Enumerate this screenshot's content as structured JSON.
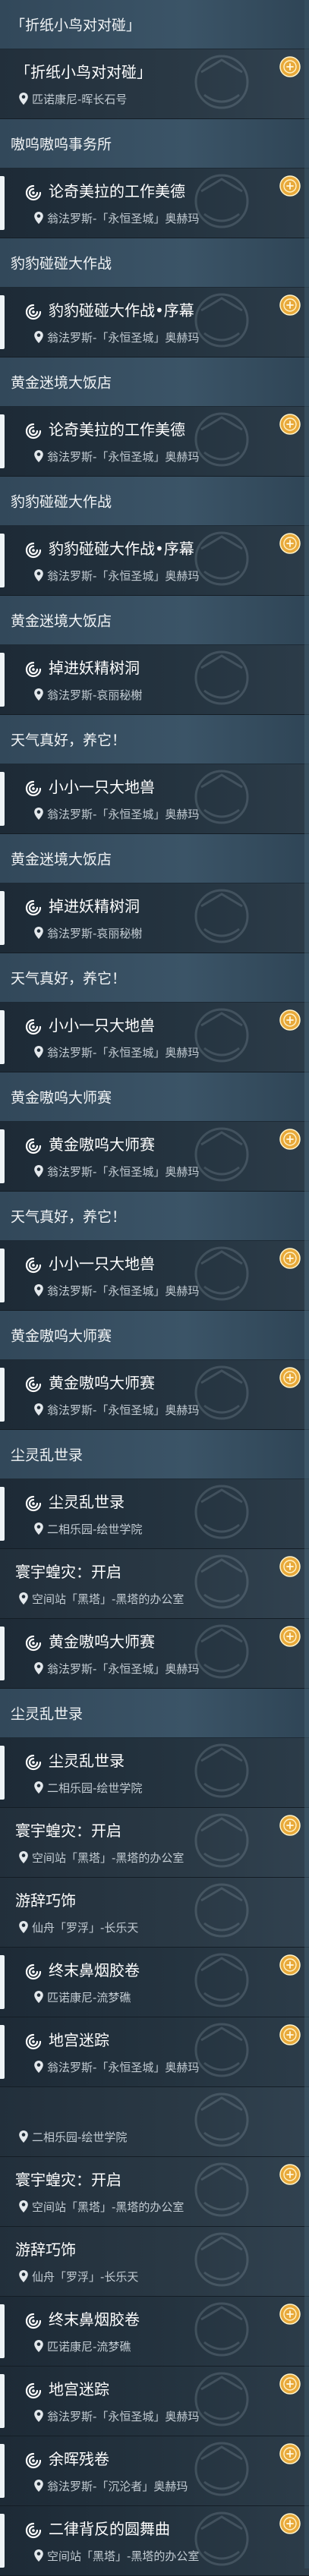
{
  "colors": {
    "header_bg": "#3b5467",
    "item_bg": "#24333f",
    "title_text": "#ffffff",
    "location_text": "#c3ccd3",
    "badge_gold": "#e8a93a"
  },
  "rows": [
    {
      "kind": "header",
      "text": "「折纸小鸟对对碰」"
    },
    {
      "kind": "item",
      "title": "「折纸小鸟对对碰」",
      "location": "匹诺康尼-晖长石号",
      "variant": "sub",
      "quest_icon": "none",
      "badge": true
    },
    {
      "kind": "header",
      "text": "嗷呜嗷呜事务所"
    },
    {
      "kind": "item",
      "title": "论奇美拉的工作美德",
      "location": "翁法罗斯-「永恒圣城」奥赫玛",
      "variant": "main",
      "quest_icon": "swirl-icon",
      "badge": true
    },
    {
      "kind": "header",
      "text": "豹豹碰碰大作战"
    },
    {
      "kind": "item",
      "title": "豹豹碰碰大作战•序幕",
      "location": "翁法罗斯-「永恒圣城」奥赫玛",
      "variant": "main",
      "quest_icon": "swirl-icon",
      "badge": true
    },
    {
      "kind": "header",
      "text": "黄金迷境大饭店"
    },
    {
      "kind": "item",
      "title": "论奇美拉的工作美德",
      "location": "翁法罗斯-「永恒圣城」奥赫玛",
      "variant": "main",
      "quest_icon": "swirl-icon",
      "badge": true
    },
    {
      "kind": "header",
      "text": "豹豹碰碰大作战"
    },
    {
      "kind": "item",
      "title": "豹豹碰碰大作战•序幕",
      "location": "翁法罗斯-「永恒圣城」奥赫玛",
      "variant": "main",
      "quest_icon": "swirl-icon",
      "badge": true
    },
    {
      "kind": "header",
      "text": "黄金迷境大饭店"
    },
    {
      "kind": "item",
      "title": "掉进妖精树洞",
      "location": "翁法罗斯-哀丽秘榭",
      "variant": "main",
      "quest_icon": "swirl-icon",
      "badge": false
    },
    {
      "kind": "header",
      "text": "天气真好，养它！"
    },
    {
      "kind": "item",
      "title": "小小一只大地兽",
      "location": "翁法罗斯-「永恒圣城」奥赫玛",
      "variant": "main",
      "quest_icon": "swirl-icon",
      "badge": false
    },
    {
      "kind": "header",
      "text": "黄金迷境大饭店"
    },
    {
      "kind": "item",
      "title": "掉进妖精树洞",
      "location": "翁法罗斯-哀丽秘榭",
      "variant": "main",
      "quest_icon": "swirl-icon",
      "badge": false
    },
    {
      "kind": "header",
      "text": "天气真好，养它！"
    },
    {
      "kind": "item",
      "title": "小小一只大地兽",
      "location": "翁法罗斯-「永恒圣城」奥赫玛",
      "variant": "main",
      "quest_icon": "swirl-icon",
      "badge": true
    },
    {
      "kind": "header",
      "text": "黄金嗷呜大师赛"
    },
    {
      "kind": "item",
      "title": "黄金嗷呜大师赛",
      "location": "翁法罗斯-「永恒圣城」奥赫玛",
      "variant": "main",
      "quest_icon": "swirl-icon",
      "badge": true
    },
    {
      "kind": "header",
      "text": "天气真好，养它！"
    },
    {
      "kind": "item",
      "title": "小小一只大地兽",
      "location": "翁法罗斯-「永恒圣城」奥赫玛",
      "variant": "main",
      "quest_icon": "swirl-icon",
      "badge": true
    },
    {
      "kind": "header",
      "text": "黄金嗷呜大师赛"
    },
    {
      "kind": "item",
      "title": "黄金嗷呜大师赛",
      "location": "翁法罗斯-「永恒圣城」奥赫玛",
      "variant": "main",
      "quest_icon": "swirl-icon",
      "badge": true
    },
    {
      "kind": "header",
      "text": "尘灵乱世录"
    },
    {
      "kind": "item",
      "title": "尘灵乱世录",
      "location": "二相乐园-绘世学院",
      "variant": "main",
      "quest_icon": "swirl-icon",
      "badge": false
    },
    {
      "kind": "item",
      "title": "寰宇蝗灾：开启",
      "location": "空间站「黑塔」-黑塔的办公室",
      "variant": "sub",
      "quest_icon": "none",
      "badge": true
    },
    {
      "kind": "item",
      "title": "黄金嗷呜大师赛",
      "location": "翁法罗斯-「永恒圣城」奥赫玛",
      "variant": "main",
      "quest_icon": "swirl-icon",
      "badge": true
    },
    {
      "kind": "header",
      "text": "尘灵乱世录"
    },
    {
      "kind": "item",
      "title": "尘灵乱世录",
      "location": "二相乐园-绘世学院",
      "variant": "main",
      "quest_icon": "swirl-icon",
      "badge": false
    },
    {
      "kind": "item",
      "title": "寰宇蝗灾：开启",
      "location": "空间站「黑塔」-黑塔的办公室",
      "variant": "sub",
      "quest_icon": "none",
      "badge": true
    },
    {
      "kind": "item",
      "title": "游辞巧饰",
      "location": "仙舟「罗浮」-长乐天",
      "variant": "sub",
      "quest_icon": "none",
      "badge": false
    },
    {
      "kind": "item",
      "title": "终末鼻烟胶卷",
      "location": "匹诺康尼-流梦礁",
      "variant": "main",
      "quest_icon": "swirl-icon",
      "badge": true
    },
    {
      "kind": "item",
      "title": "地宫迷踪",
      "location": "翁法罗斯-「永恒圣城」奥赫玛",
      "variant": "main",
      "quest_icon": "swirl-icon",
      "badge": true
    },
    {
      "kind": "item",
      "title": "",
      "location": "二相乐园-绘世学院",
      "variant": "sub",
      "quest_icon": "none",
      "badge": false
    },
    {
      "kind": "item",
      "title": "寰宇蝗灾：开启",
      "location": "空间站「黑塔」-黑塔的办公室",
      "variant": "sub",
      "quest_icon": "none",
      "badge": true
    },
    {
      "kind": "item",
      "title": "游辞巧饰",
      "location": "仙舟「罗浮」-长乐天",
      "variant": "sub",
      "quest_icon": "none",
      "badge": false
    },
    {
      "kind": "item",
      "title": "终末鼻烟胶卷",
      "location": "匹诺康尼-流梦礁",
      "variant": "main",
      "quest_icon": "swirl-icon",
      "badge": true
    },
    {
      "kind": "item",
      "title": "地宫迷踪",
      "location": "翁法罗斯-「永恒圣城」奥赫玛",
      "variant": "main",
      "quest_icon": "swirl-icon",
      "badge": true
    },
    {
      "kind": "item",
      "title": "余晖残卷",
      "location": "翁法罗斯-「沉沦者」奥赫玛",
      "variant": "main",
      "quest_icon": "swirl-icon",
      "badge": true
    },
    {
      "kind": "item",
      "title": "二律背反的圆舞曲",
      "location": "空间站「黑塔」-黑塔的办公室",
      "variant": "main",
      "quest_icon": "swirl-icon",
      "badge": true
    }
  ]
}
